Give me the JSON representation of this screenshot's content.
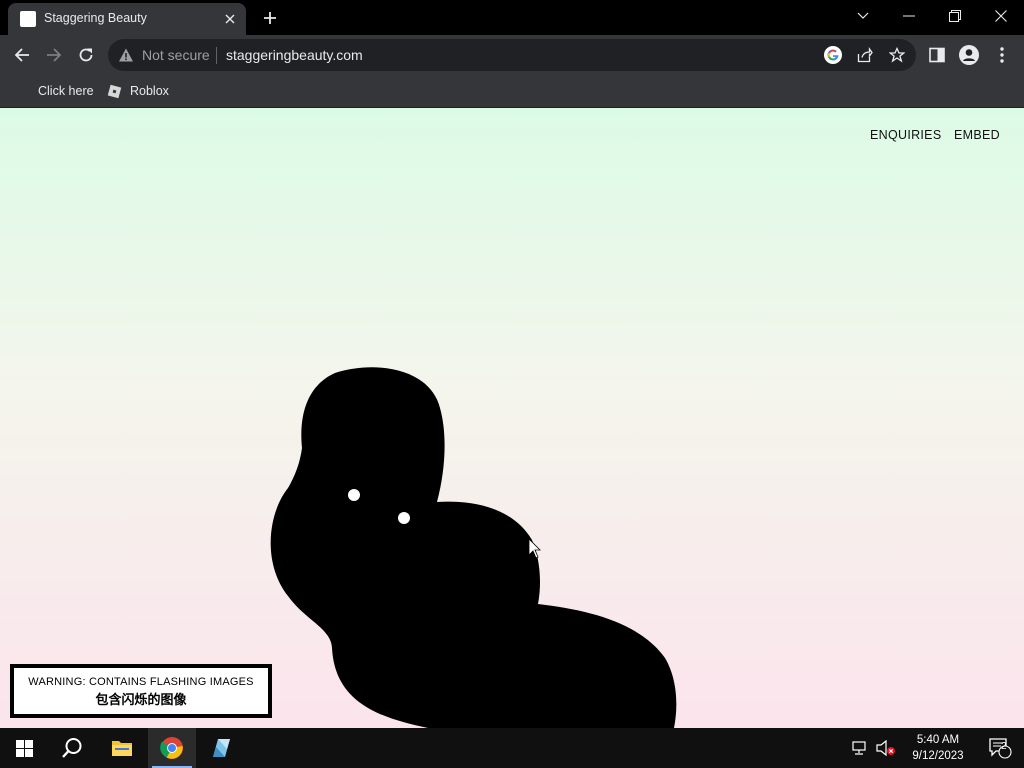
{
  "browser": {
    "tab_title": "Staggering Beauty",
    "security_label": "Not secure",
    "url": "staggeringbeauty.com"
  },
  "bookmarks": [
    {
      "label": "Click here"
    },
    {
      "label": "Roblox"
    }
  ],
  "page": {
    "nav": {
      "enquiries": "ENQUIRIES",
      "embed": "EMBED"
    },
    "warning_en": "WARNING: CONTAINS FLASHING IMAGES",
    "warning_zh": "包含闪烁的图像"
  },
  "taskbar": {
    "time": "5:40 AM",
    "date": "9/12/2023",
    "notification_count": "2"
  },
  "colors": {
    "page_top": "#dcfbe6",
    "page_bottom": "#fbe4ec",
    "chrome_dark": "#35363a",
    "creature": "#000000"
  },
  "icons": [
    "tab-favicon",
    "close-icon",
    "plus-icon",
    "chevron-down-icon",
    "minimize-icon",
    "restore-icon",
    "close-window-icon",
    "back-icon",
    "forward-icon",
    "reload-icon",
    "warning-icon",
    "google-icon",
    "share-icon",
    "star-icon",
    "side-panel-icon",
    "profile-icon",
    "menu-icon",
    "roblox-icon",
    "windows-start-icon",
    "search-icon",
    "file-explorer-icon",
    "chrome-icon",
    "app-icon",
    "network-icon",
    "volume-muted-icon",
    "notification-icon",
    "cursor-icon"
  ]
}
